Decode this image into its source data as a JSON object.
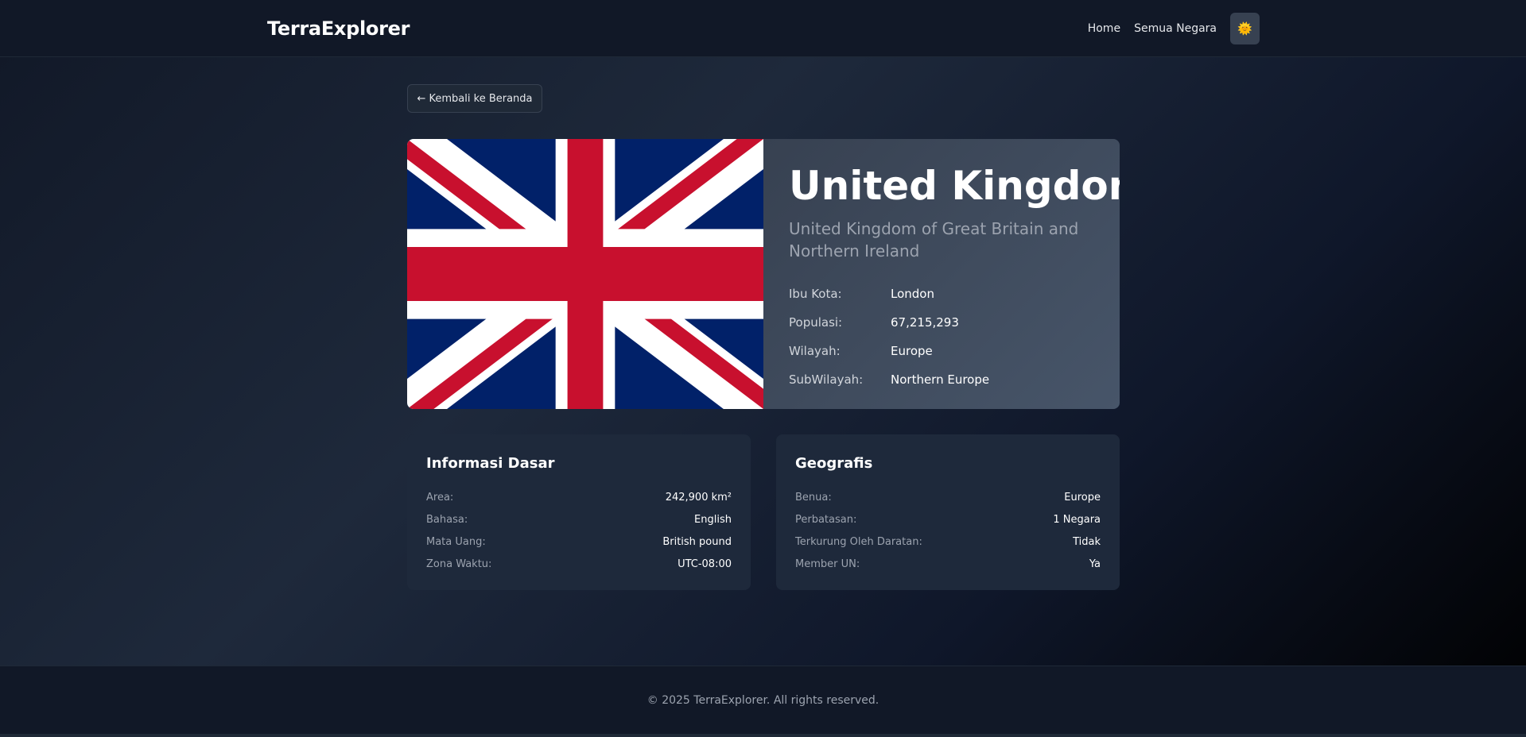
{
  "header": {
    "brand": "TerraExplorer",
    "nav": [
      {
        "label": "Home"
      },
      {
        "label": "Semua Negara"
      }
    ],
    "theme_icon": "sun-icon",
    "theme_glyph": "🌞"
  },
  "back_button": {
    "label": "← Kembali ke Beranda"
  },
  "country": {
    "name": "United Kingdom",
    "official_name": "United Kingdom of Great Britain and Northern Ireland",
    "flag_icon": "union-jack-flag",
    "stats": [
      {
        "label": "Ibu Kota:",
        "value": "London"
      },
      {
        "label": "Populasi:",
        "value": "67,215,293"
      },
      {
        "label": "Wilayah:",
        "value": "Europe"
      },
      {
        "label": "SubWilayah:",
        "value": "Northern Europe"
      }
    ]
  },
  "basic_info": {
    "title": "Informasi Dasar",
    "rows": [
      {
        "label": "Area:",
        "value": "242,900 km²"
      },
      {
        "label": "Bahasa:",
        "value": "English"
      },
      {
        "label": "Mata Uang:",
        "value": "British pound"
      },
      {
        "label": "Zona Waktu:",
        "value": "UTC-08:00"
      }
    ]
  },
  "geography": {
    "title": "Geografis",
    "rows": [
      {
        "label": "Benua:",
        "value": "Europe"
      },
      {
        "label": "Perbatasan:",
        "value": "1 Negara"
      },
      {
        "label": "Terkurung Oleh Daratan:",
        "value": "Tidak"
      },
      {
        "label": "Member UN:",
        "value": "Ya"
      }
    ]
  },
  "footer": {
    "text": "© 2025 TerraExplorer. All rights reserved."
  },
  "colors": {
    "flag_blue": "#012169",
    "flag_red": "#C8102E",
    "flag_white": "#FFFFFF"
  }
}
